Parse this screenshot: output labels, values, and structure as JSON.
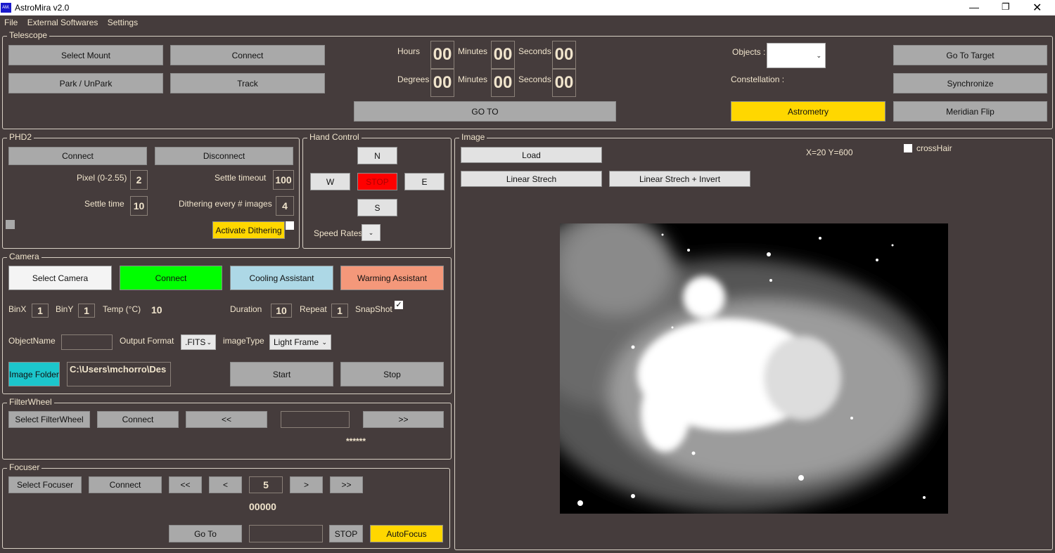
{
  "window": {
    "title": "AstroMira v2.0",
    "logo": "AM."
  },
  "menu": [
    "File",
    "External Softwares",
    "Settings"
  ],
  "telescope": {
    "title": "Telescope",
    "select_mount": "Select Mount",
    "connect": "Connect",
    "park": "Park / UnPark",
    "track": "Track",
    "hours": "Hours",
    "degrees": "Degrees",
    "minutes": "Minutes",
    "seconds": "Seconds",
    "ra": [
      "00",
      "00",
      "00"
    ],
    "dec": [
      "00",
      "00",
      "00"
    ],
    "goto": "GO TO",
    "objects": "Objects :",
    "constellation": "Constellation :",
    "go_to_target": "Go To Target",
    "synchronize": "Synchronize",
    "astrometry": "Astrometry",
    "meridian_flip": "Meridian Flip"
  },
  "phd2": {
    "title": "PHD2",
    "connect": "Connect",
    "disconnect": "Disconnect",
    "pixel_label": "Pixel (0-2.55)",
    "pixel": "2",
    "settle_timeout_label": "Settle timeout",
    "settle_timeout": "100",
    "settle_time_label": "Settle time",
    "settle_time": "10",
    "dither_label": "Dithering every # images",
    "dither": "4",
    "activate": "Activate Dithering",
    "activate_checked": false
  },
  "hand": {
    "title": "Hand Control",
    "n": "N",
    "s": "S",
    "e": "E",
    "w": "W",
    "stop": "STOP",
    "speed": "Speed Rates"
  },
  "camera": {
    "title": "Camera",
    "select": "Select Camera",
    "connect": "Connect",
    "cooling": "Cooling Assistant",
    "warming": "Warming Assistant",
    "binx_label": "BinX",
    "binx": "1",
    "biny_label": "BinY",
    "biny": "1",
    "temp_label": "Temp (°C)",
    "temp": "10",
    "duration_label": "Duration",
    "duration": "10",
    "repeat_label": "Repeat",
    "repeat": "1",
    "snapshot_label": "SnapShot",
    "snapshot_checked": true,
    "object_label": "ObjectName",
    "object": "",
    "format_label": "Output Format",
    "format": ".FITS",
    "type_label": "imageType",
    "type": "Light Frame",
    "folder": "Image Folder",
    "path": "C:\\Users\\mchorro\\Des",
    "start": "Start",
    "stop": "Stop"
  },
  "filterwheel": {
    "title": "FilterWheel",
    "select": "Select FilterWheel",
    "connect": "Connect",
    "prev": "<<",
    "next": ">>",
    "filter": "",
    "status": "******"
  },
  "focuser": {
    "title": "Focuser",
    "select": "Select Focuser",
    "connect": "Connect",
    "ff": "<<",
    "f": "<",
    "step": "5",
    "b": ">",
    "bb": ">>",
    "position": "00000",
    "goto": "Go To",
    "target": "",
    "stop": "STOP",
    "autofocus": "AutoFocus"
  },
  "image": {
    "title": "Image",
    "load": "Load",
    "linear": "Linear Strech",
    "linear_invert": "Linear Strech + Invert",
    "coords": "X=20 Y=600",
    "crosshair": "crossHair",
    "crosshair_checked": false
  },
  "colors": {
    "background": "#453c3c",
    "yellow": "#ffd700",
    "green": "#00ff00",
    "red": "#ff0000",
    "light_blue": "#add8e6",
    "salmon": "#f4987a",
    "cyan": "#1cc6cc"
  }
}
